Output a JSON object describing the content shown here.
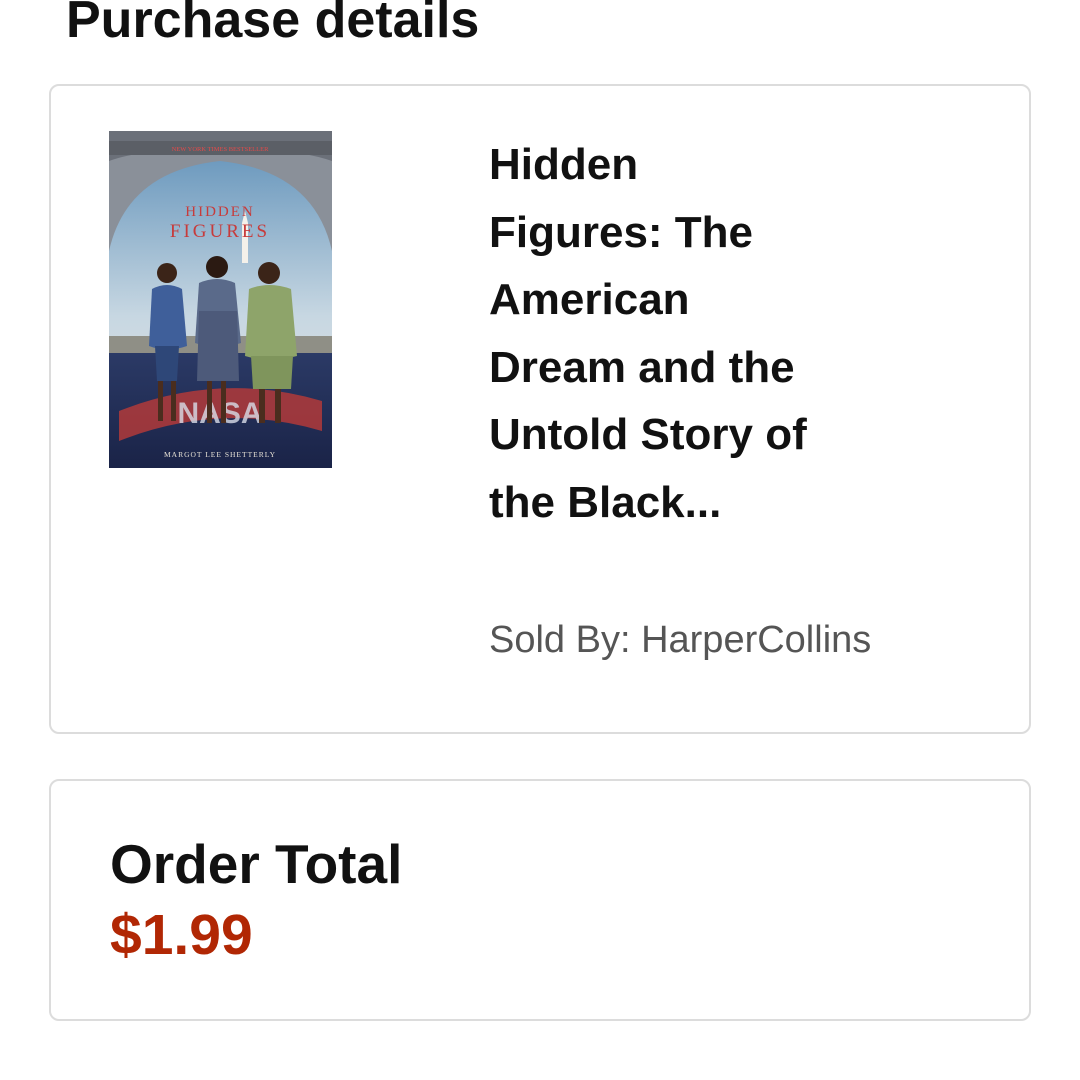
{
  "header": {
    "title": "Purchase details"
  },
  "product": {
    "title": "Hidden Figures: The American Dream and the Untold Story of the Black...",
    "sold_by": "Sold By: HarperCollins",
    "cover": {
      "banner": "NEW YORK TIMES BESTSELLER",
      "title_line1": "HIDDEN",
      "title_line2": "FIGURES",
      "author": "MARGOT LEE SHETTERLY"
    }
  },
  "order": {
    "label": "Order Total",
    "total": "$1.99"
  },
  "colors": {
    "price": "#b12704",
    "card_border": "#dcdcdc",
    "secondary_text": "#555555"
  }
}
